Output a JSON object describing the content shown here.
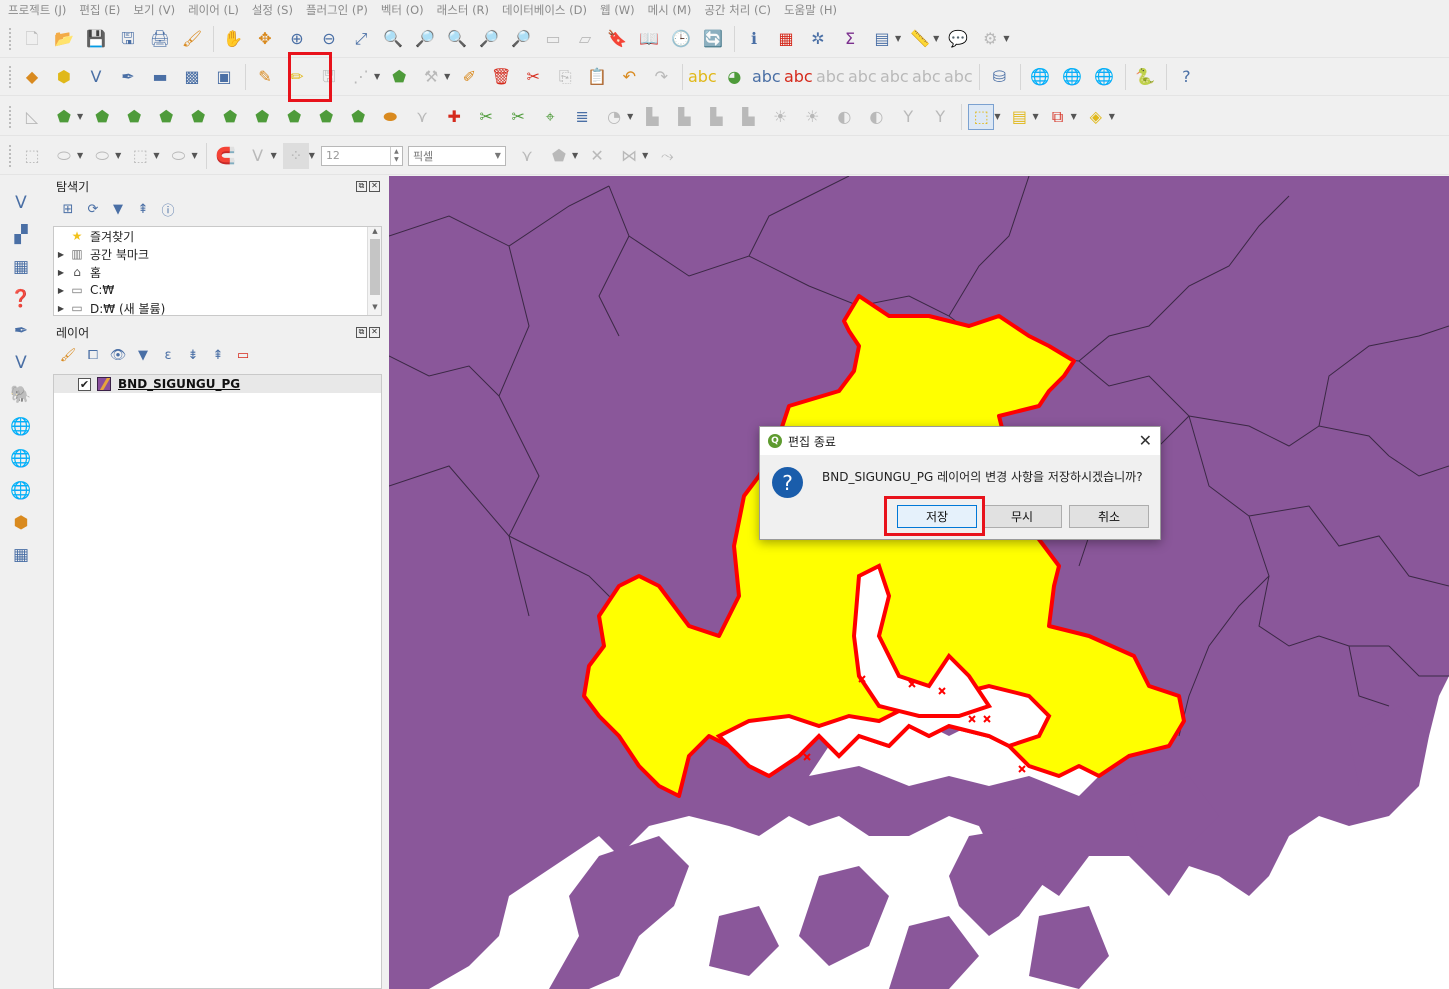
{
  "menubar": {
    "items": [
      "프로젝트 (J)",
      "편집 (E)",
      "보기 (V)",
      "레이어 (L)",
      "설정 (S)",
      "플러그인 (P)",
      "벡터 (O)",
      "래스터 (R)",
      "데이터베이스 (D)",
      "웹 (W)",
      "메시 (M)",
      "공간 처리 (C)",
      "도움말 (H)"
    ]
  },
  "snapping": {
    "tolerance": "12",
    "unit": "픽셀"
  },
  "browser": {
    "title": "탐색기",
    "items": [
      {
        "label": "즐겨찾기",
        "icon": "star-icon"
      },
      {
        "label": "공간 북마크",
        "icon": "bookmark-icon"
      },
      {
        "label": "홈",
        "icon": "home-icon"
      },
      {
        "label": "C:₩",
        "icon": "folder-icon"
      },
      {
        "label": "D:₩ (새 볼륨)",
        "icon": "folder-icon"
      }
    ]
  },
  "layers": {
    "title": "레이어",
    "items": [
      {
        "name": "BND_SIGUNGU_PG",
        "checked": true
      }
    ]
  },
  "dialog": {
    "title": "편집 종료",
    "message": "BND_SIGUNGU_PG 레이어의 변경 사항을 저장하시겠습니까?",
    "buttons": {
      "save": "저장",
      "ignore": "무시",
      "cancel": "취소"
    }
  },
  "colors": {
    "region_fill": "#8a579a",
    "selected_fill": "#ffff00",
    "selected_outline": "#ff0000",
    "highlight": "#e8121b"
  }
}
